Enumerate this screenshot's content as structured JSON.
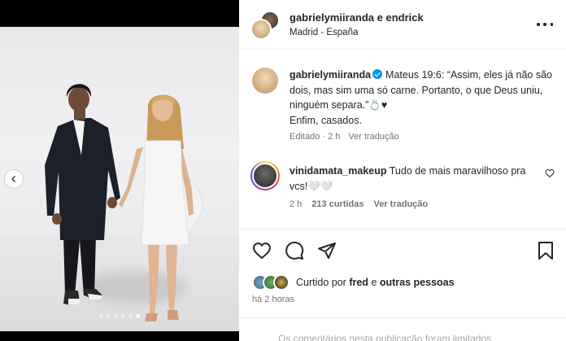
{
  "post": {
    "header": {
      "title": "gabrielymiiranda e endrick",
      "location": "Madrid - España"
    },
    "caption": {
      "username": "gabrielymiiranda",
      "text": "Mateus 19:6: “Assim, eles já não são dois, mas sim uma só carne. Portanto, o que Deus uniu, ninguém separa.”💍♥",
      "line2": "Enfim, casados.",
      "edited": "Editado · 2 h",
      "see_translation": "Ver tradução"
    },
    "comment": {
      "username": "vinidamata_makeup",
      "text": "Tudo de mais maravilhoso pra vcs!🤍🤍",
      "time": "2 h",
      "likes": "213 curtidas",
      "see_translation": "Ver tradução"
    },
    "likes": {
      "prefix": "Curtido por",
      "user": "fred",
      "and": "e",
      "others": "outras pessoas"
    },
    "time_ago": "há 2 horas",
    "comments_limited": "Os comentários nesta publicação foram limitados."
  },
  "carousel": {
    "total": 6,
    "active": 6
  },
  "icons": {
    "like": "heart-icon",
    "comment": "comment-icon",
    "share": "send-icon",
    "save": "bookmark-icon",
    "more": "more-options-icon",
    "prev": "chevron-left-icon"
  },
  "colors": {
    "verified": "#0095f6",
    "secondary_text": "#737373"
  }
}
